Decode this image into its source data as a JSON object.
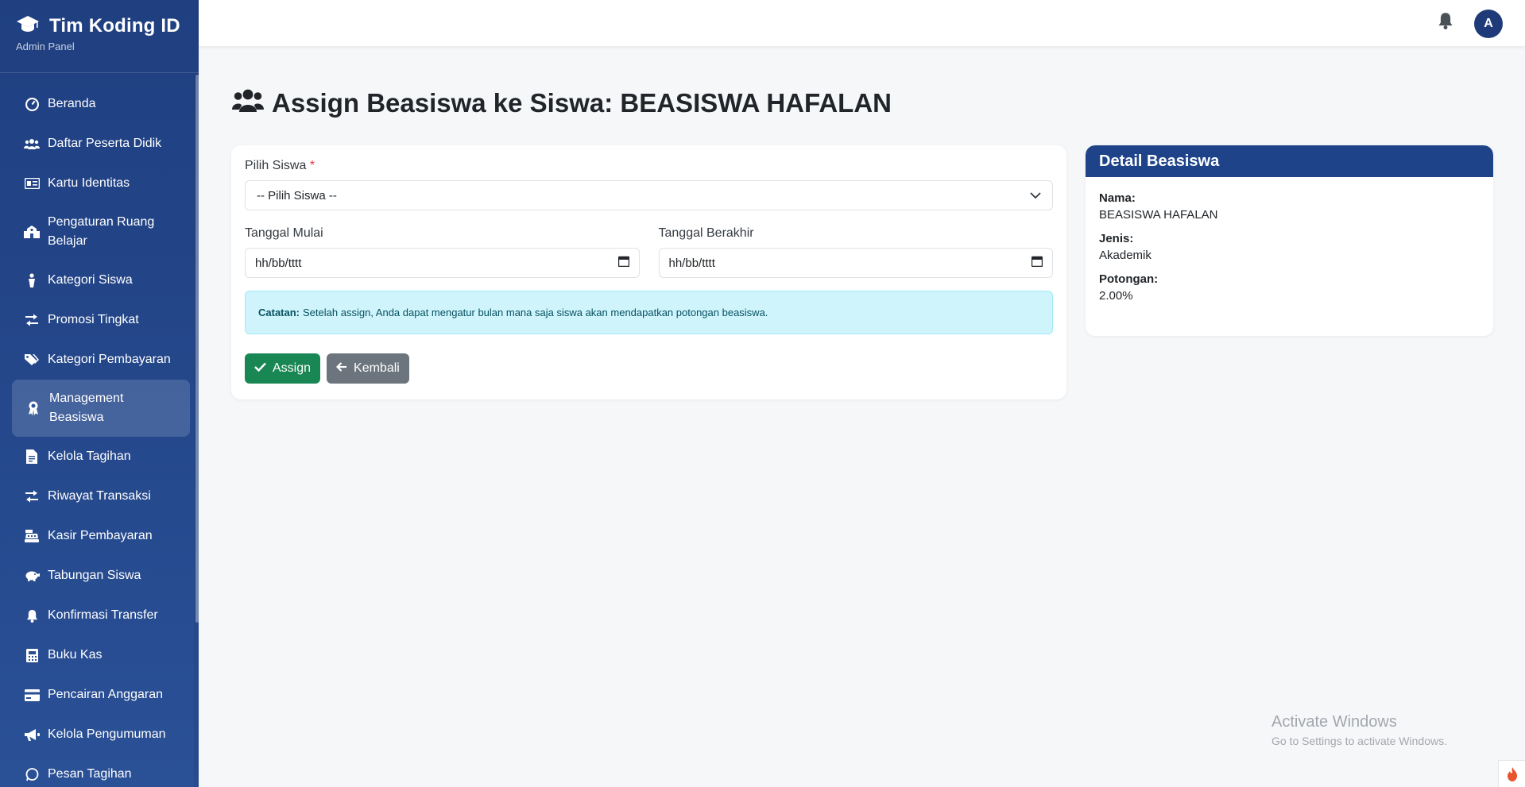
{
  "brand": {
    "title": "Tim Koding ID",
    "subtitle": "Admin Panel"
  },
  "sidebar": {
    "items": [
      {
        "label": "Beranda",
        "icon": "dashboard-icon"
      },
      {
        "label": "Daftar Peserta Didik",
        "icon": "users-icon"
      },
      {
        "label": "Kartu Identitas",
        "icon": "id-card-icon"
      },
      {
        "label": "Pengaturan Ruang Belajar",
        "icon": "school-icon"
      },
      {
        "label": "Kategori Siswa",
        "icon": "person-icon"
      },
      {
        "label": "Promosi Tingkat",
        "icon": "exchange-icon"
      },
      {
        "label": "Kategori Pembayaran",
        "icon": "tags-icon"
      },
      {
        "label": "Management Beasiswa",
        "icon": "award-icon"
      },
      {
        "label": "Kelola Tagihan",
        "icon": "invoice-icon"
      },
      {
        "label": "Riwayat Transaksi",
        "icon": "exchange-icon"
      },
      {
        "label": "Kasir Pembayaran",
        "icon": "cash-register-icon"
      },
      {
        "label": "Tabungan Siswa",
        "icon": "piggy-bank-icon"
      },
      {
        "label": "Konfirmasi Transfer",
        "icon": "bell-icon"
      },
      {
        "label": "Buku Kas",
        "icon": "book-icon"
      },
      {
        "label": "Pencairan Anggaran",
        "icon": "card-icon"
      },
      {
        "label": "Kelola Pengumuman",
        "icon": "megaphone-icon"
      },
      {
        "label": "Pesan Tagihan",
        "icon": "whatsapp-icon"
      }
    ]
  },
  "topbar": {
    "avatar_letter": "A"
  },
  "page": {
    "title": "Assign Beasiswa ke Siswa: BEASISWA HAFALAN"
  },
  "form": {
    "siswa_label": "Pilih Siswa",
    "required_mark": "*",
    "siswa_selected": "-- Pilih Siswa --",
    "mulai_label": "Tanggal Mulai",
    "mulai_value": "hh/bb/tttt",
    "akhir_label": "Tanggal Berakhir",
    "akhir_value": "hh/bb/tttt",
    "note_title": "Catatan:",
    "note_text": "Setelah assign, Anda dapat mengatur bulan mana saja siswa akan mendapatkan potongan beasiswa.",
    "assign_label": "Assign",
    "back_label": "Kembali"
  },
  "detail": {
    "title": "Detail Beasiswa",
    "nama_label": "Nama:",
    "nama_value": "BEASISWA HAFALAN",
    "jenis_label": "Jenis:",
    "jenis_value": "Akademik",
    "potongan_label": "Potongan:",
    "potongan_value": "2.00%"
  },
  "watermark": {
    "line1": "Activate Windows",
    "line2": "Go to Settings to activate Windows."
  },
  "colors": {
    "sidebar": "#1f3f80",
    "accent": "#1e4389",
    "success": "#198754",
    "secondary": "#6c757d",
    "info_bg": "#cff4fc"
  }
}
